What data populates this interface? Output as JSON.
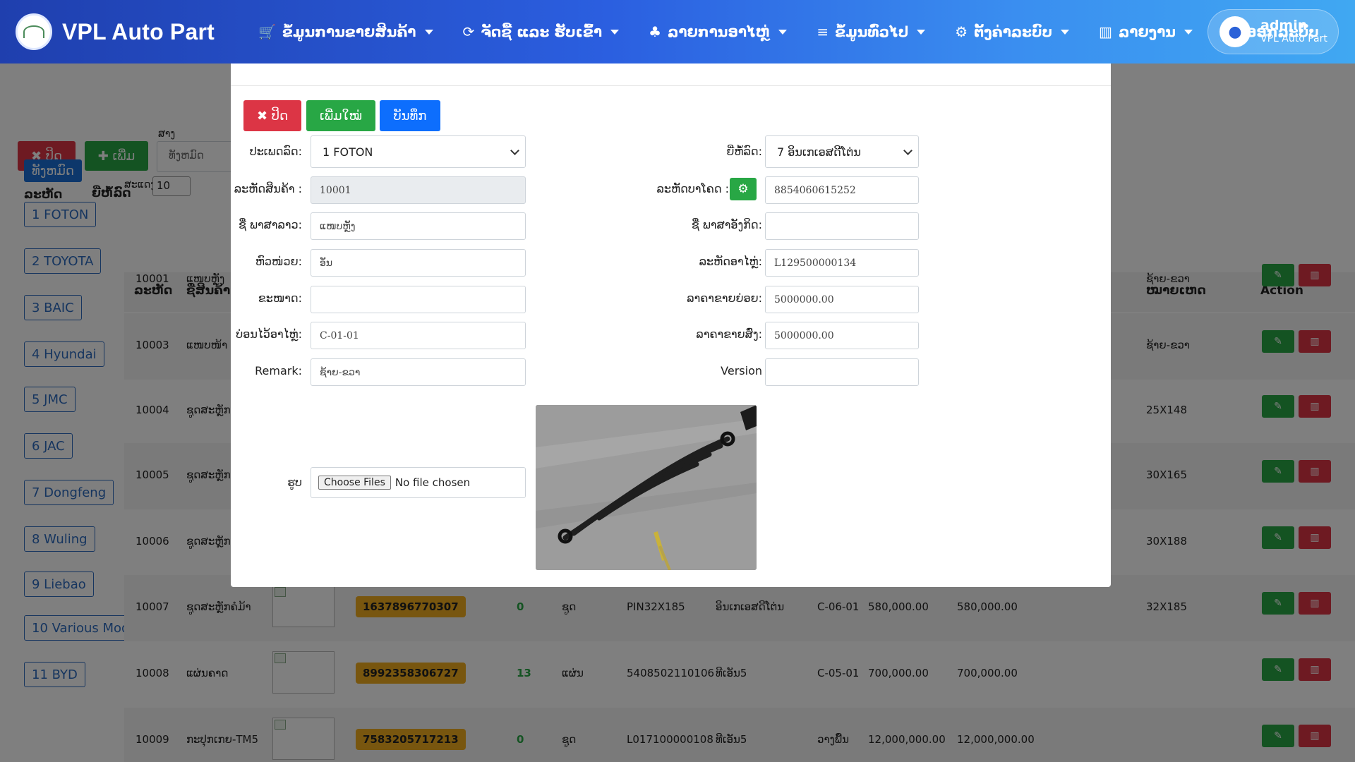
{
  "navbar": {
    "brand": "VPL Auto Part",
    "menu": [
      {
        "icon": "cart-icon",
        "glyph": "🛒",
        "label": "ຂໍ້ມູນການຂາຍສິນຄ້າ",
        "caret": true
      },
      {
        "icon": "refresh-icon",
        "glyph": "⟳",
        "label": "ຈັດຊື້ ແລະ ຮັບເຂົ້າ",
        "caret": true
      },
      {
        "icon": "sitemap-icon",
        "glyph": "♣",
        "label": "ລາຍການອາໄຫຼ່",
        "caret": true
      },
      {
        "icon": "list-icon",
        "glyph": "≡",
        "label": "ຂໍ້ມູນທົ່ວໄປ",
        "caret": true
      },
      {
        "icon": "gear-icon",
        "glyph": "⚙",
        "label": "ຕັ້ງຄ່າລະບົບ",
        "caret": true
      },
      {
        "icon": "bar-chart-icon",
        "glyph": "▥",
        "label": "ລາຍງານ",
        "caret": true
      },
      {
        "icon": "lock-icon",
        "glyph": "🔒",
        "label": "ອອກລະບົບ",
        "caret": false
      }
    ],
    "user": {
      "name": "admin",
      "org": "VPL Auto Part"
    }
  },
  "background": {
    "close_label": "✖ ປິດ",
    "add_label": "✚ ເພີ່ມ",
    "search_label": "ສາງ",
    "search_placeholder": "ທັງຫມົດ",
    "col_code": "ລະຫັດ",
    "col_brand": "ຍີ່ຫໍ້ລົດ",
    "rows_label": "ສະແດງ",
    "rows_value": "10",
    "categories": [
      "ທັງຫມົດ",
      "1 FOTON",
      "2 TOYOTA",
      "3 BAIC",
      "4 Hyundai",
      "5 JMC",
      "6 JAC",
      "7 Dongfeng",
      "8 Wuling",
      "9 Liebao",
      "10 Various Models",
      "11 BYD"
    ],
    "table_headers": {
      "code": "ລະຫັດ",
      "name": "ຊື່ສິນຄ້າ",
      "note": "ໝາຍເຫດ",
      "action": "Action"
    },
    "rows": [
      {
        "code": "10001",
        "name": "ແໜບຫຼັງ",
        "barcode": "",
        "qty": "",
        "unit": "",
        "part": "",
        "brand": "",
        "loc": "",
        "price1": "",
        "price2": "",
        "note": "ຊ້າຍ-ຂວາ"
      },
      {
        "code": "10003",
        "name": "ແໜບໜ້າ",
        "barcode": "",
        "qty": "",
        "unit": "",
        "part": "",
        "brand": "",
        "loc": "",
        "price1": "",
        "price2": "",
        "note": "ຊ້າຍ-ຂວາ"
      },
      {
        "code": "10004",
        "name": "ຊູດສະຫຼັກຄໍ",
        "barcode": "",
        "qty": "",
        "unit": "",
        "part": "",
        "brand": "",
        "loc": "",
        "price1": "",
        "price2": "",
        "note": "25X148"
      },
      {
        "code": "10005",
        "name": "ຊູດສະຫຼັກຄໍ",
        "barcode": "",
        "qty": "",
        "unit": "",
        "part": "",
        "brand": "",
        "loc": "",
        "price1": "",
        "price2": "",
        "note": "30X165"
      },
      {
        "code": "10006",
        "name": "ຊູດສະຫຼັກຄໍ",
        "barcode": "",
        "qty": "",
        "unit": "",
        "part": "",
        "brand": "",
        "loc": "",
        "price1": "",
        "price2": "",
        "note": "30X188"
      },
      {
        "code": "10007",
        "name": "ຊູດສະຫຼັກຄໍມ້າ",
        "barcode": "1637896770307",
        "qty": "0",
        "unit": "ຊູດ",
        "part": "PIN32X185",
        "brand": "ອິນເກເອສດີໂຕ່ນ",
        "loc": "C-06-01",
        "price1": "580,000.00",
        "price2": "580,000.00",
        "note": "32X185"
      },
      {
        "code": "10008",
        "name": "ແຜ່ນຄາດ",
        "barcode": "8992358306727",
        "qty": "13",
        "unit": "ແຜ່ນ",
        "part": "5408502110106",
        "brand": "ທີເອັນ5",
        "loc": "C-05-01",
        "price1": "700,000.00",
        "price2": "700,000.00",
        "note": ""
      },
      {
        "code": "10009",
        "name": "ກະປຸກເກຍ-TM5",
        "barcode": "7583205717213",
        "qty": "0",
        "unit": "ຊູດ",
        "part": "L017100000108",
        "brand": "ທີເອັນ5",
        "loc": "ວາງພື້ນ",
        "price1": "12,000,000.00",
        "price2": "12,000,000.00",
        "note": ""
      }
    ]
  },
  "modal": {
    "buttons": {
      "close": "✖ ປິດ",
      "new": "ເພີ່ມໃໝ່",
      "save": "ບັນທຶກ"
    },
    "fields": {
      "car_type": {
        "label": "ປະເພດລົດ:",
        "value": "1  FOTON"
      },
      "car_brand": {
        "label": "ຍີ່ຫໍ້ລົດ:",
        "value": "7 ອິນເກເອສດີໂຕ່ນ"
      },
      "product_code": {
        "label": "ລະຫັດສິນຄ້າ :",
        "value": "10001"
      },
      "barcode": {
        "label": "ລະຫັດບາໂຄດ :",
        "value": "8854060615252"
      },
      "name_lao": {
        "label": "ຊື່ ພາສາລາວ:",
        "value": "ແໜບຫຼັງ"
      },
      "name_en": {
        "label": "ຊື່ ພາສາອັງກິດ:",
        "value": ""
      },
      "unit": {
        "label": "ຫົວໜ່ວຍ:",
        "value": "ອັນ"
      },
      "part_code": {
        "label": "ລະຫັດອາໄຫຼ່:",
        "value": "L129500000134"
      },
      "size": {
        "label": "ຂະໜາດ:",
        "value": ""
      },
      "retail_price": {
        "label": "ລາຄາຂາຍຍ່ອຍ:",
        "value": "5000000.00"
      },
      "location": {
        "label": "ບ່ອນໄວ້ອາໄຫຼ່:",
        "value": "C-01-01"
      },
      "wholesale_price": {
        "label": "ລາຄາຂາຍສົ່ງ:",
        "value": "5000000.00"
      },
      "remark": {
        "label": "Remark:",
        "value": "ຊ້າຍ-ຂວາ"
      },
      "version": {
        "label": "Version",
        "value": ""
      },
      "image": {
        "label": "ຮູບ",
        "button": "Choose Files",
        "status": "No file chosen"
      }
    }
  }
}
